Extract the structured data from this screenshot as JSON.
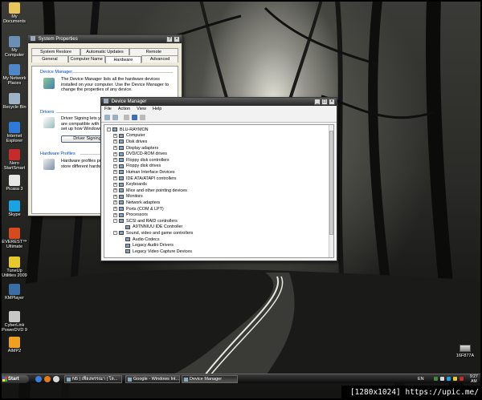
{
  "desktop_icons": [
    {
      "label": "My Documents",
      "color": "#e8c65a"
    },
    {
      "label": "My Computer",
      "color": "#6a8fb5"
    },
    {
      "label": "My Network Places",
      "color": "#4f87c9"
    },
    {
      "label": "Recycle Bin",
      "color": "#9fb3c8"
    },
    {
      "label": "Internet Explorer",
      "color": "#2f7ad8"
    },
    {
      "label": "Nero StartSmart",
      "color": "#c62b2b"
    },
    {
      "label": "Picasa 3",
      "color": "#e6e6e6"
    },
    {
      "label": "Skype",
      "color": "#1aa3e0"
    },
    {
      "label": "EVEREST™ Ultimate",
      "color": "#d64a1e"
    },
    {
      "label": "TuneUp Utilities 2009",
      "color": "#e7c92c"
    },
    {
      "label": "KMPlayer",
      "color": "#3a6ea5"
    },
    {
      "label": "CyberLink PowerDVD 9",
      "color": "#c8c8c8"
    },
    {
      "label": "AIMP2",
      "color": "#f0a020"
    }
  ],
  "hdd_icon": {
    "label": "16F877A"
  },
  "system_properties": {
    "title": "System Properties",
    "tabs_row1": [
      "System Restore",
      "Automatic Updates",
      "Remote"
    ],
    "tabs_row2": [
      "General",
      "Computer Name",
      "Hardware",
      "Advanced"
    ],
    "active_tab": "Hardware",
    "device_manager": {
      "heading": "Device Manager",
      "text": "The Device Manager lists all the hardware devices installed on your computer. Use the Device Manager to change the properties of any device."
    },
    "drivers": {
      "heading": "Drivers",
      "text": "Driver Signing lets you make sure that installed drivers are compatible with Windows. Windows Update lets you set up how Windows connects to Windows Update for drivers.",
      "button": "Driver Signing"
    },
    "hardware_profiles": {
      "heading": "Hardware Profiles",
      "text": "Hardware profiles provide a way for you to set up and store different hardware configurations."
    }
  },
  "device_manager": {
    "title": "Device Manager",
    "menu": [
      "File",
      "Action",
      "View",
      "Help"
    ],
    "tree": [
      {
        "label": "BLU-RAYMON",
        "level": 0,
        "expander": "-"
      },
      {
        "label": "Computer",
        "level": 1,
        "expander": "+"
      },
      {
        "label": "Disk drives",
        "level": 1,
        "expander": "+"
      },
      {
        "label": "Display adapters",
        "level": 1,
        "expander": "+"
      },
      {
        "label": "DVD/CD-ROM drives",
        "level": 1,
        "expander": "+"
      },
      {
        "label": "Floppy disk controllers",
        "level": 1,
        "expander": "+"
      },
      {
        "label": "Floppy disk drives",
        "level": 1,
        "expander": "+"
      },
      {
        "label": "Human Interface Devices",
        "level": 1,
        "expander": "+"
      },
      {
        "label": "IDE ATA/ATAPI controllers",
        "level": 1,
        "expander": "+"
      },
      {
        "label": "Keyboards",
        "level": 1,
        "expander": "+"
      },
      {
        "label": "Mice and other pointing devices",
        "level": 1,
        "expander": "+"
      },
      {
        "label": "Monitors",
        "level": 1,
        "expander": "+"
      },
      {
        "label": "Network adapters",
        "level": 1,
        "expander": "+"
      },
      {
        "label": "Ports (COM & LPT)",
        "level": 1,
        "expander": "+"
      },
      {
        "label": "Processors",
        "level": 1,
        "expander": "+"
      },
      {
        "label": "SCSI and RAID controllers",
        "level": 1,
        "expander": "-"
      },
      {
        "label": "A9TNNIUU IDE Controller",
        "level": 2,
        "expander": ""
      },
      {
        "label": "Sound, video and game controllers",
        "level": 1,
        "expander": "-"
      },
      {
        "label": "Audio Codecs",
        "level": 2,
        "expander": ""
      },
      {
        "label": "Legacy Audio Drivers",
        "level": 2,
        "expander": ""
      },
      {
        "label": "Legacy Video Capture Devices",
        "level": 2,
        "expander": ""
      }
    ]
  },
  "taskbar": {
    "start_label": "Start",
    "buttons": [
      {
        "label": "N5 | เฟียงพรรณา | โล...",
        "active": false
      },
      {
        "label": "Google - Windows Int...",
        "active": false
      },
      {
        "label": "Device Manager",
        "active": true
      }
    ],
    "language": "EN",
    "clock_time": "9:27",
    "clock_period": "AM"
  },
  "watermark": "[1280x1024] https://upic.me/"
}
